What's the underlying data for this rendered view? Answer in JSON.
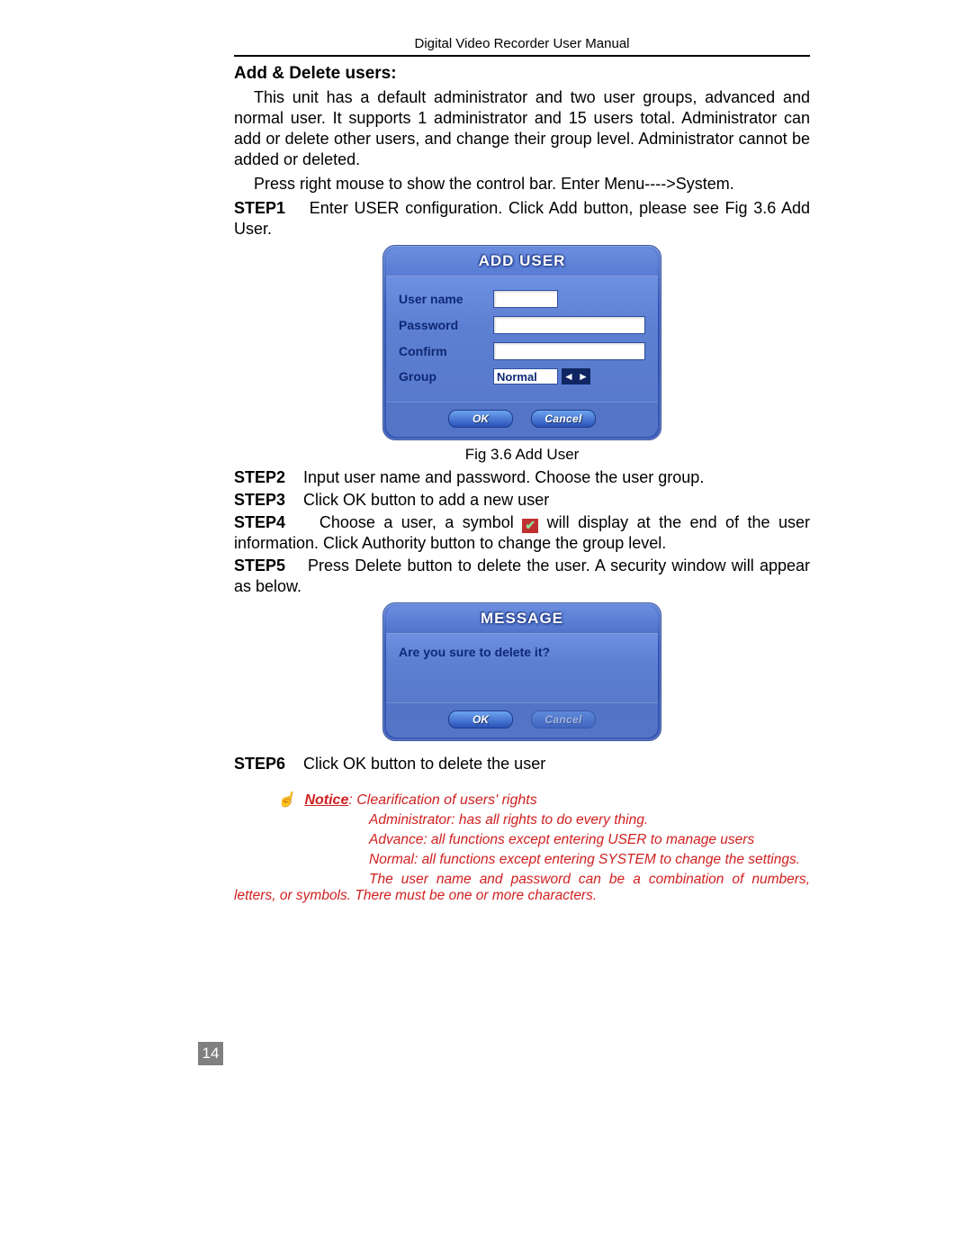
{
  "header": "Digital Video Recorder User Manual",
  "section_title": "Add & Delete users:",
  "intro": "This unit has a default administrator and two user groups, advanced and normal user. It supports 1 administrator and 15 users total. Administrator can add or delete other users, and change their group level. Administrator cannot be added or deleted.",
  "nav_hint": "Press right mouse to show the control bar. Enter Menu---->System.",
  "step1": {
    "label": "STEP1",
    "text": "Enter USER configuration. Click Add button, please see Fig 3.6 Add User."
  },
  "add_user_dialog": {
    "title": "ADD USER",
    "fields": {
      "username_label": "User name",
      "password_label": "Password",
      "confirm_label": "Confirm",
      "group_label": "Group",
      "group_value": "Normal"
    },
    "ok": "OK",
    "cancel": "Cancel"
  },
  "fig_caption_1": "Fig 3.6 Add User",
  "step2": {
    "label": "STEP2",
    "text": "Input user name and password. Choose the user group."
  },
  "step3": {
    "label": "STEP3",
    "text": "Click OK button to add a new user"
  },
  "step4": {
    "label": "STEP4",
    "text_before": "Choose a user, a symbol ",
    "text_after": " will display at the end of the user information. Click Authority button to change the group level."
  },
  "step5": {
    "label": "STEP5",
    "text": "Press Delete button to delete the user. A security window will appear as below."
  },
  "message_dialog": {
    "title": "MESSAGE",
    "body": "Are you sure to delete it?",
    "ok": "OK",
    "cancel": "Cancel"
  },
  "step6": {
    "label": "STEP6",
    "text": "Click OK button to delete the user"
  },
  "notice": {
    "label": "Notice",
    "head_rest": ": Clearification of users' rights",
    "lines": [
      "Administrator: has all rights to do every thing.",
      "Advance: all functions except entering USER to manage users",
      "Normal: all functions except entering SYSTEM to change the settings."
    ],
    "para": "The user name and password can be a combination of numbers, letters, or symbols. There must be one or more characters."
  },
  "page_number": "14"
}
